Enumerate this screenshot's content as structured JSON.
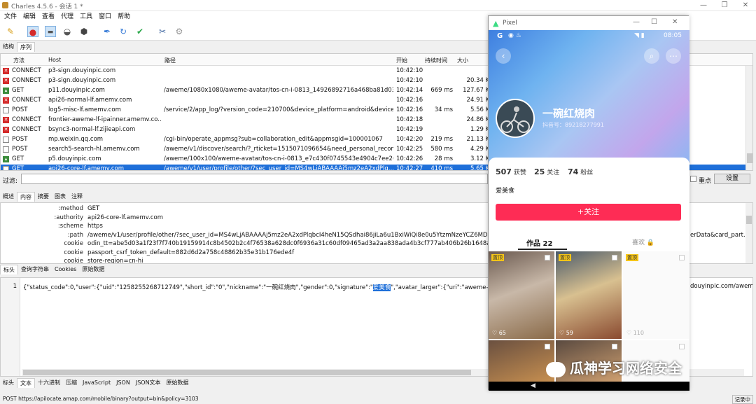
{
  "window": {
    "title": "Charles 4.5.6 - 会话 1 *"
  },
  "menu": [
    "文件",
    "编辑",
    "查看",
    "代理",
    "工具",
    "窗口",
    "帮助"
  ],
  "view_tabs": [
    "结构",
    "序列"
  ],
  "columns": [
    "方法",
    "Host",
    "路径",
    "开始",
    "持续时间",
    "大小"
  ],
  "rows": [
    {
      "icon": "x",
      "method": "CONNECT",
      "host": "p3-sign.douyinpic.com",
      "path": "",
      "start": "10:42:10",
      "dur": "",
      "size": ""
    },
    {
      "icon": "x",
      "method": "CONNECT",
      "host": "p3-sign.douyinpic.com",
      "path": "",
      "start": "10:42:10",
      "dur": "",
      "size": "20.34 KB"
    },
    {
      "icon": "i",
      "method": "GET",
      "host": "p11.douyinpic.com",
      "path": "/aweme/1080x1080/aweme-avatar/tos-cn-i-0813_14926892716a468ba81d03ff...",
      "start": "10:42:14",
      "dur": "669 ms",
      "size": "127.67 KB"
    },
    {
      "icon": "x",
      "method": "CONNECT",
      "host": "api26-normal-lf.amemv.com",
      "path": "",
      "start": "10:42:16",
      "dur": "",
      "size": "24.91 KB"
    },
    {
      "icon": "d",
      "method": "POST",
      "host": "log5-misc-lf.amemv.com",
      "path": "/service/2/app_log/?version_code=210700&device_platform=android&device...",
      "start": "10:42:16",
      "dur": "34 ms",
      "size": "5.56 KB"
    },
    {
      "icon": "x",
      "method": "CONNECT",
      "host": "frontier-aweme-lf-ipainner.amemv.co...",
      "path": "",
      "start": "10:42:18",
      "dur": "",
      "size": "24.86 KB"
    },
    {
      "icon": "x",
      "method": "CONNECT",
      "host": "bsync3-normal-lf.zijieapi.com",
      "path": "",
      "start": "10:42:19",
      "dur": "",
      "size": "1.29 KB"
    },
    {
      "icon": "d",
      "method": "POST",
      "host": "mp.weixin.qq.com",
      "path": "/cgi-bin/operate_appmsg?sub=collaboration_edit&appmsgid=100001067",
      "start": "10:42:20",
      "dur": "219 ms",
      "size": "21.13 KB"
    },
    {
      "icon": "d",
      "method": "POST",
      "host": "search5-search-hl.amemv.com",
      "path": "/aweme/v1/discover/search/?_rticket=1515071096654&need_personal_recom...",
      "start": "10:42:25",
      "dur": "580 ms",
      "size": "4.29 KB"
    },
    {
      "icon": "i",
      "method": "GET",
      "host": "p5.douyinpic.com",
      "path": "/aweme/100x100/aweme-avatar/tos-cn-i-0813_e7c430f0745543e4904c7ee262...",
      "start": "10:42:26",
      "dur": "28 ms",
      "size": "3.12 KB"
    },
    {
      "icon": "d",
      "method": "GET",
      "host": "api26-core-lf.amemv.com",
      "path": "/aweme/v1/user/profile/other/?sec_user_id=MS4wLjABAAAAj5mz2eA2xdPlq...",
      "start": "10:42:27",
      "dur": "410 ms",
      "size": "5.65 KB",
      "selected": true
    }
  ],
  "filter": {
    "label": "过滤:",
    "focus": "重点",
    "settings": "设置"
  },
  "detail_tabs": [
    "概述",
    "内容",
    "摘要",
    "图表",
    "注释"
  ],
  "headers": [
    {
      "k": ":method",
      "v": "GET"
    },
    {
      "k": ":authority",
      "v": "api26-core-lf.amemv.com"
    },
    {
      "k": ":scheme",
      "v": "https"
    },
    {
      "k": ":path",
      "v": "/aweme/v1/user/profile/other/?sec_user_id=MS4wLjABAAAAj5mz2eA2xdPlqbcI4heN15QSdhai86jiLa6u1BxiWiQi8e0u5YtzmNzeYCZ6MD-q&"
    },
    {
      "k": "cookie",
      "v": "odin_tt=abe5d03a1f23f7f740b19159914c8b4502b2c4f76538a628dc0f6936a31c60df09465ad3a2aa838ada4b3cf777ab406b26b1648ae2f938"
    },
    {
      "k": "cookie",
      "v": "passport_csrf_token_default=882d6d2a758c48862b35e31b176ede4f"
    },
    {
      "k": "cookie",
      "v": "store-region=cn-hi"
    }
  ],
  "headers_right": "erData&card_part.",
  "sub_tabs1": [
    "标头",
    "查询字符串",
    "Cookies",
    "原始数据"
  ],
  "body_line_no": "1",
  "body_text": "{\"status_code\":0,\"user\":{\"uid\":\"1258255268712749\",\"short_id\":\"0\",\"nickname\":\"一碗红烧肉\",\"gender\":0,\"signature\":\"",
  "body_highlight": "爱美食",
  "body_text2": "\",\"avatar_larger\":{\"uri\":\"aweme-avatar/tos-cn",
  "body_right": "douyinpic.com/aweme/",
  "sub_tabs2": [
    "标头",
    "文本",
    "十六进制",
    "压缩",
    "JavaScript",
    "JSON",
    "JSON文本",
    "原始数据"
  ],
  "status": {
    "left": "POST https://apilocate.amap.com/mobile/binary?output=bin&policy=3103",
    "right": "记录中"
  },
  "phone": {
    "window_title": "Pixel",
    "time": "08:05",
    "nickname": "一碗红烧肉",
    "douyin_id": "抖音号：89218277991",
    "stats": [
      {
        "n": "507",
        "l": "获赞"
      },
      {
        "n": "25",
        "l": "关注"
      },
      {
        "n": "74",
        "l": "粉丝"
      }
    ],
    "bio": "爱美食",
    "follow": "+关注",
    "tab_works": "作品 22",
    "tab_likes": "喜欢",
    "pinned": "置顶",
    "grid_likes": [
      "65",
      "59",
      "110"
    ],
    "accent": "#fe2c55"
  },
  "watermark": "瓜神学习网络安全"
}
